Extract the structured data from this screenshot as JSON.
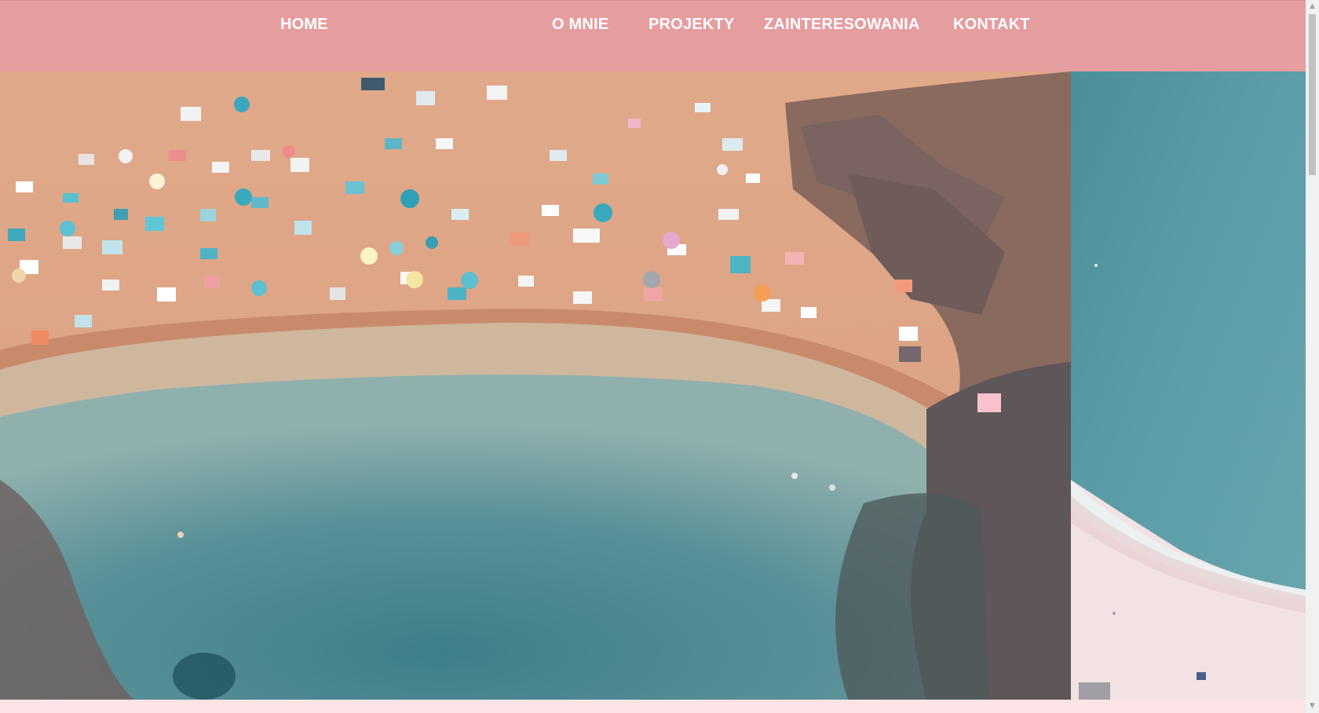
{
  "nav": {
    "home": "HOME",
    "o_mnie": "O MNIE",
    "projekty": "PROJEKTY",
    "zainteresowania": "ZAINTERESOWANIA",
    "kontakt": "KONTAKT"
  },
  "hero": {
    "main_image": "aerial-beach-photo",
    "side_image": "aerial-shoreline-photo"
  },
  "scrollbar": {
    "up_icon": "scroll-up-arrow",
    "down_icon": "scroll-down-arrow"
  },
  "colors": {
    "navbar_bg": "#e69d9f",
    "nav_text": "#ffffff",
    "page_bg": "#fbe3e6"
  }
}
